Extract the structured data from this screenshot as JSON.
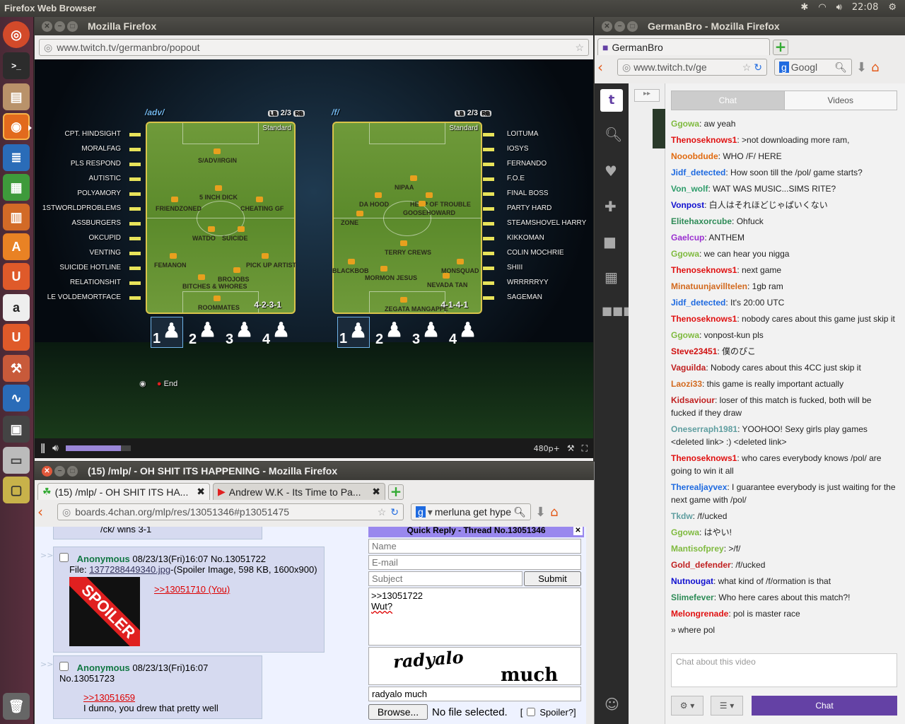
{
  "topbar": {
    "title": "Firefox Web Browser",
    "time": "22:08"
  },
  "launcher": {
    "items": [
      "dash-icon",
      "terminal-icon",
      "files-icon",
      "firefox-icon",
      "writer-icon",
      "calc-icon",
      "impress-icon",
      "software-center-icon",
      "ubuntu-one-icon",
      "amazon-icon",
      "ubuntu-one-music-icon",
      "settings-icon",
      "system-monitor-icon",
      "workspace-icon",
      "drive-icon",
      "vm-icon",
      "trash-icon"
    ]
  },
  "win1": {
    "title": "Mozilla Firefox",
    "url": "www.twitch.tv/germanbro/popout"
  },
  "game": {
    "left": {
      "board": "/adv/",
      "page": "2/3",
      "style": "Standard",
      "formation": "4-2-3-1",
      "names": [
        "CPT. HINDSIGHT",
        "MORALFAG",
        "PLS RESPOND",
        "AUTISTIC",
        "POLYAMORY",
        "1STWORLDPROBLEMS",
        "ASSBURGERS",
        "OKCUPID",
        "VENTING",
        "SUICIDE HOTLINE",
        "RELATIONSHIT",
        "LE VOLDEMORTFACE"
      ],
      "pitch": [
        "S/ADV/IRGIN",
        "5 INCH DICK",
        "FRIENDZONED",
        "CHEATING GF",
        "WATDO",
        "SUICIDE",
        "FEMANON",
        "PICK UP ARTIST",
        "BROJOBS",
        "BITCHES & WHORES",
        "ROOMMATES"
      ]
    },
    "right": {
      "board": "/f/",
      "page": "2/3",
      "style": "Standard",
      "formation": "4-1-4-1",
      "names": [
        "LOITUMA",
        "IOSYS",
        "FERNANDO",
        "F.O.E",
        "FINAL BOSS",
        "PARTY HARD",
        "STEAMSHOVEL HARRY",
        "KIKKOMAN",
        "COLIN MOCHRIE",
        "SHIII",
        "WRRRRRYY",
        "SAGEMAN"
      ],
      "pitch": [
        "NIPAA",
        "DA HOOD",
        "HEAP OF TROUBLE",
        "GOOSEHOWARD",
        "ZONE",
        "TERRY CREWS",
        "BLACKBOB",
        "MONSQUAD",
        "MORMON JESUS",
        "NEVADA TAN",
        "ZEGATA MANGAPPE"
      ]
    },
    "lb": "LB",
    "rb": "RB",
    "numbers": [
      "1",
      "2",
      "3",
      "4"
    ],
    "end": "End"
  },
  "player": {
    "quality": "480p+",
    "volume": 0.85
  },
  "win2": {
    "title": "(15) /mlp/ - OH SHIT ITS HAPPENING - Mozilla Firefox",
    "tabs": [
      "(15) /mlp/ - OH SHIT ITS HA...",
      "Andrew W.K - Its Time to Pa..."
    ],
    "url": "boards.4chan.org/mlp/res/13051346#p13051475",
    "search": "merluna get hype"
  },
  "thread": {
    "top_fragment": "/ck/ wins 3-1",
    "posts": [
      {
        "name": "Anonymous",
        "date": "08/23/13(Fri)16:07",
        "no": "No.13051722",
        "file_label": "File:",
        "file": "1377288449340.jpg",
        "file_info": "-(Spoiler Image, 598 KB, 1600x900)",
        "spoiler": "SPOILER",
        "quote": ">>13051710 (You)",
        "text": ""
      },
      {
        "name": "Anonymous",
        "date": "08/23/13(Fri)16:07",
        "no": "No.13051723",
        "quote": ">>13051659",
        "text": "I dunno, you drew that pretty well"
      }
    ],
    "arrows": ">>"
  },
  "quickreply": {
    "title": "Quick Reply - Thread No.13051346",
    "name_ph": "Name",
    "email_ph": "E-mail",
    "subject_ph": "Subject",
    "submit": "Submit",
    "comment_l1": ">>13051722",
    "comment_l2": "Wut?",
    "captcha_w1": "radyalo",
    "captcha_w2": "much",
    "captcha_input": "radyalo much",
    "browse": "Browse...",
    "nofile": "No file selected.",
    "spoiler": "Spoiler?]",
    "bracket": "["
  },
  "win3": {
    "title": "GermanBro - Mozilla Firefox",
    "tab": "GermanBro",
    "url": "www.twitch.tv/ge",
    "search": "Googl"
  },
  "twitch": {
    "chat_tab": "Chat",
    "videos_tab": "Videos",
    "placeholder": "Chat about this video",
    "chat_button": "Chat",
    "messages": [
      {
        "user": "Ggowa",
        "color": "#7fba3f",
        "text": ": aw yeah"
      },
      {
        "user": "Thenoseknows1",
        "color": "#e01010",
        "text": ": >not downloading more ram,"
      },
      {
        "user": "Nooobdude",
        "color": "#e06a10",
        "text": ": WHO /F/ HERE"
      },
      {
        "user": "Jidf_detected",
        "color": "#1e6ae0",
        "text": ": How soon till the /pol/ game starts?"
      },
      {
        "user": "Von_wolf",
        "color": "#2e9c6a",
        "text": ": WAT WAS MUSIC...SIMS RITE?"
      },
      {
        "user": "Vonpost",
        "color": "#1010d0",
        "text": ": 白人はそれほどじゃぱいくない"
      },
      {
        "user": "Elitehaxorcube",
        "color": "#2e8b57",
        "text": ": Ohfuck"
      },
      {
        "user": "Gaelcup",
        "color": "#9a30d0",
        "text": ": ANTHEM"
      },
      {
        "user": "Ggowa",
        "color": "#7fba3f",
        "text": ": we can hear you nigga"
      },
      {
        "user": "Thenoseknows1",
        "color": "#e01010",
        "text": ": next game"
      },
      {
        "user": "Minatuunjavilltelen",
        "color": "#d2691e",
        "text": ": 1gb ram"
      },
      {
        "user": "Jidf_detected",
        "color": "#1e6ae0",
        "text": ": It's 20:00 UTC"
      },
      {
        "user": "Thenoseknows1",
        "color": "#e01010",
        "text": ": nobody cares about this game just skip it"
      },
      {
        "user": "Ggowa",
        "color": "#7fba3f",
        "text": ": vonpost-kun pls"
      },
      {
        "user": "Steve23451",
        "color": "#d01010",
        "text": ": 僕のぴこ"
      },
      {
        "user": "Vaguilda",
        "color": "#c02020",
        "text": ": Nobody cares about this 4CC just skip it"
      },
      {
        "user": "Laozi33",
        "color": "#d2691e",
        "text": ": this game is really important actually"
      },
      {
        "user": "Kidsaviour",
        "color": "#c02020",
        "text": ": loser of this match is fucked, both will be fucked if they draw"
      },
      {
        "user": "Oneserraph1981",
        "color": "#5f9ea0",
        "text": ": YOOHOO! Sexy girls play games <deleted link> :) <deleted link>"
      },
      {
        "user": "Thenoseknows1",
        "color": "#e01010",
        "text": ": who cares everybody knows /pol/ are going to win it all"
      },
      {
        "user": "Therealjayvex",
        "color": "#1e6ae0",
        "text": ": I guarantee everybody is just waiting for the next game with /pol/"
      },
      {
        "user": "Tkdw",
        "color": "#5f9ea0",
        "text": ": /f/ucked"
      },
      {
        "user": "Ggowa",
        "color": "#7fba3f",
        "text": ": はやい!"
      },
      {
        "user": "Mantisofprey",
        "color": "#7fba3f",
        "text": ": >/f/"
      },
      {
        "user": "Gold_defender",
        "color": "#c02020",
        "text": ": /f/ucked"
      },
      {
        "user": "Nutnougat",
        "color": "#1010d0",
        "text": ": what kind of /f/ormation is that"
      },
      {
        "user": "Slimefever",
        "color": "#2e8b57",
        "text": ": Who here cares about this match?!"
      },
      {
        "user": "Melongrenade",
        "color": "#e01010",
        "text": ": pol is master race"
      },
      {
        "user": "",
        "color": "#222222",
        "text": "» where pol"
      }
    ]
  }
}
